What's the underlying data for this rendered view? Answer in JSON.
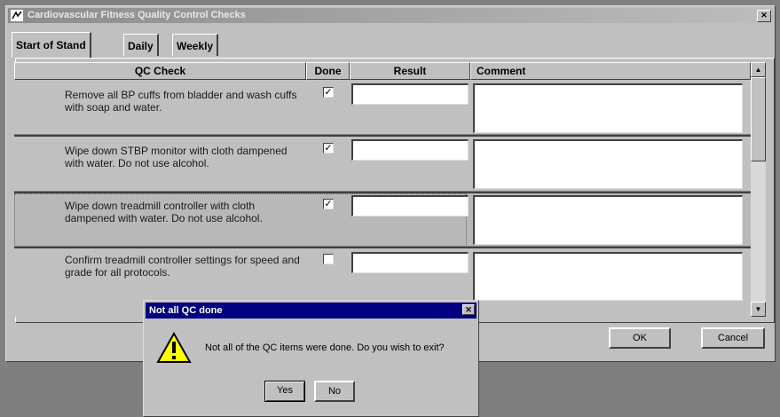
{
  "window": {
    "title": "Cardiovascular Fitness Quality Control Checks",
    "close_glyph": "✕"
  },
  "tabs": [
    {
      "label": "Start of Stand",
      "active": true
    },
    {
      "label": "Daily",
      "active": false
    },
    {
      "label": "Weekly",
      "active": false
    }
  ],
  "grid": {
    "headers": {
      "check": "QC Check",
      "done": "Done",
      "result": "Result",
      "comment": "Comment"
    },
    "rows": [
      {
        "check": "Remove all BP cuffs from bladder and wash cuffs with soap and water.",
        "done": true,
        "done_glyph": "✓",
        "result": "",
        "comment": ""
      },
      {
        "check": "Wipe down STBP monitor with cloth dampened with water.  Do not use alcohol.",
        "done": true,
        "done_glyph": "✓",
        "result": "",
        "comment": ""
      },
      {
        "check": "Wipe down treadmill controller with cloth dampened with water.  Do not use alcohol.",
        "done": true,
        "done_glyph": "✓",
        "result": "",
        "comment": ""
      },
      {
        "check": "Confirm treadmill controller settings for speed and grade for all protocols.",
        "done": false,
        "done_glyph": "",
        "result": "",
        "comment": ""
      }
    ]
  },
  "scrollbar": {
    "up_glyph": "▲",
    "down_glyph": "▼"
  },
  "buttons": {
    "ok": "OK",
    "cancel": "Cancel"
  },
  "dialog": {
    "title": "Not all QC done",
    "close_glyph": "✕",
    "message": "Not all of the QC items were done. Do you wish to exit?",
    "icon": "warning-icon",
    "yes": "Yes",
    "no": "No"
  }
}
